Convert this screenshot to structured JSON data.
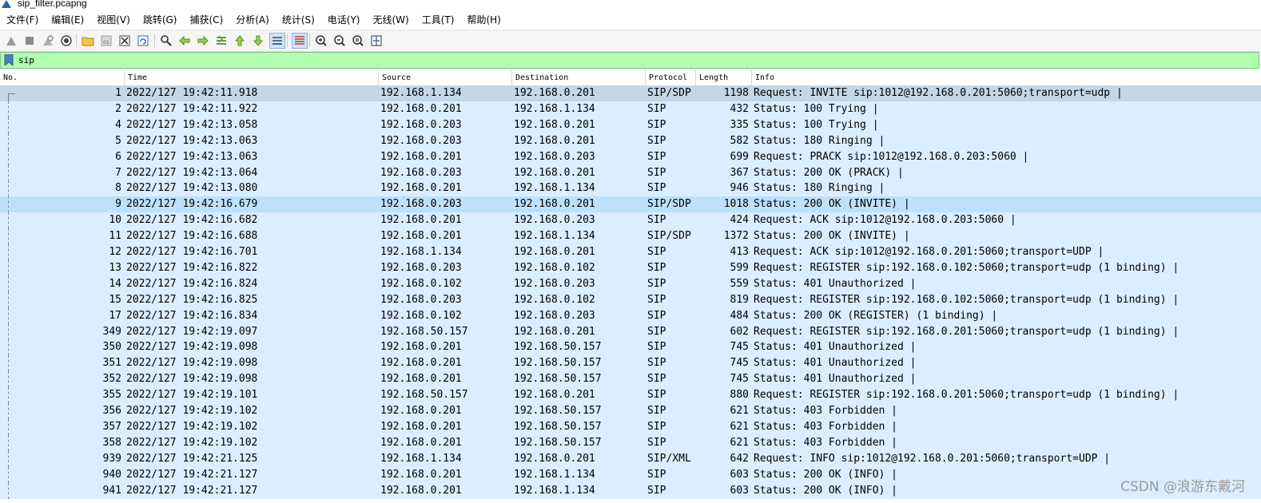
{
  "window": {
    "title": "sip_filter.pcapng"
  },
  "menu": [
    "文件(F)",
    "编辑(E)",
    "视图(V)",
    "跳转(G)",
    "捕获(C)",
    "分析(A)",
    "统计(S)",
    "电话(Y)",
    "无线(W)",
    "工具(T)",
    "帮助(H)"
  ],
  "toolbar_icons": [
    "shark-fin-start-icon",
    "stop-capture-icon",
    "restart-capture-icon",
    "capture-options-icon",
    "open-file-icon",
    "save-file-icon",
    "close-file-icon",
    "reload-file-icon",
    "find-packet-icon",
    "go-back-icon",
    "go-forward-icon",
    "go-to-packet-icon",
    "go-first-packet-icon",
    "go-last-packet-icon",
    "auto-scroll-icon",
    "colorize-icon",
    "zoom-in-icon",
    "zoom-out-icon",
    "zoom-normal-icon",
    "resize-columns-icon"
  ],
  "filter": {
    "value": "sip"
  },
  "columns": [
    "No.",
    "Time",
    "Source",
    "Destination",
    "Protocol",
    "Length",
    "Info"
  ],
  "colors": {
    "row": "#daeeff",
    "selected": "#c4d7e6",
    "highlight": "#bee0fb",
    "filter_bg": "#afffaf"
  },
  "packets": [
    {
      "no": "1",
      "time": "2022/127 19:42:11.918",
      "src": "192.168.1.134",
      "dst": "192.168.0.201",
      "proto": "SIP/SDP",
      "len": "1198",
      "info": "Request: INVITE sip:1012@192.168.0.201:5060;transport=udp |"
    },
    {
      "no": "2",
      "time": "2022/127 19:42:11.922",
      "src": "192.168.0.201",
      "dst": "192.168.1.134",
      "proto": "SIP",
      "len": "432",
      "info": "Status: 100 Trying |"
    },
    {
      "no": "4",
      "time": "2022/127 19:42:13.058",
      "src": "192.168.0.203",
      "dst": "192.168.0.201",
      "proto": "SIP",
      "len": "335",
      "info": "Status: 100 Trying |"
    },
    {
      "no": "5",
      "time": "2022/127 19:42:13.063",
      "src": "192.168.0.203",
      "dst": "192.168.0.201",
      "proto": "SIP",
      "len": "582",
      "info": "Status: 180 Ringing |"
    },
    {
      "no": "6",
      "time": "2022/127 19:42:13.063",
      "src": "192.168.0.201",
      "dst": "192.168.0.203",
      "proto": "SIP",
      "len": "699",
      "info": "Request: PRACK sip:1012@192.168.0.203:5060 |"
    },
    {
      "no": "7",
      "time": "2022/127 19:42:13.064",
      "src": "192.168.0.203",
      "dst": "192.168.0.201",
      "proto": "SIP",
      "len": "367",
      "info": "Status: 200 OK (PRACK) |"
    },
    {
      "no": "8",
      "time": "2022/127 19:42:13.080",
      "src": "192.168.0.201",
      "dst": "192.168.1.134",
      "proto": "SIP",
      "len": "946",
      "info": "Status: 180 Ringing |"
    },
    {
      "no": "9",
      "time": "2022/127 19:42:16.679",
      "src": "192.168.0.203",
      "dst": "192.168.0.201",
      "proto": "SIP/SDP",
      "len": "1018",
      "info": "Status: 200 OK (INVITE) |"
    },
    {
      "no": "10",
      "time": "2022/127 19:42:16.682",
      "src": "192.168.0.201",
      "dst": "192.168.0.203",
      "proto": "SIP",
      "len": "424",
      "info": "Request: ACK sip:1012@192.168.0.203:5060 |"
    },
    {
      "no": "11",
      "time": "2022/127 19:42:16.688",
      "src": "192.168.0.201",
      "dst": "192.168.1.134",
      "proto": "SIP/SDP",
      "len": "1372",
      "info": "Status: 200 OK (INVITE) |"
    },
    {
      "no": "12",
      "time": "2022/127 19:42:16.701",
      "src": "192.168.1.134",
      "dst": "192.168.0.201",
      "proto": "SIP",
      "len": "413",
      "info": "Request: ACK sip:1012@192.168.0.201:5060;transport=UDP |"
    },
    {
      "no": "13",
      "time": "2022/127 19:42:16.822",
      "src": "192.168.0.203",
      "dst": "192.168.0.102",
      "proto": "SIP",
      "len": "599",
      "info": "Request: REGISTER sip:192.168.0.102:5060;transport=udp  (1 binding) |"
    },
    {
      "no": "14",
      "time": "2022/127 19:42:16.824",
      "src": "192.168.0.102",
      "dst": "192.168.0.203",
      "proto": "SIP",
      "len": "559",
      "info": "Status: 401 Unauthorized |"
    },
    {
      "no": "15",
      "time": "2022/127 19:42:16.825",
      "src": "192.168.0.203",
      "dst": "192.168.0.102",
      "proto": "SIP",
      "len": "819",
      "info": "Request: REGISTER sip:192.168.0.102:5060;transport=udp  (1 binding) |"
    },
    {
      "no": "17",
      "time": "2022/127 19:42:16.834",
      "src": "192.168.0.102",
      "dst": "192.168.0.203",
      "proto": "SIP",
      "len": "484",
      "info": "Status: 200 OK (REGISTER)  (1 binding) |"
    },
    {
      "no": "349",
      "time": "2022/127 19:42:19.097",
      "src": "192.168.50.157",
      "dst": "192.168.0.201",
      "proto": "SIP",
      "len": "602",
      "info": "Request: REGISTER sip:192.168.0.201:5060;transport=udp  (1 binding) |"
    },
    {
      "no": "350",
      "time": "2022/127 19:42:19.098",
      "src": "192.168.0.201",
      "dst": "192.168.50.157",
      "proto": "SIP",
      "len": "745",
      "info": "Status: 401 Unauthorized |"
    },
    {
      "no": "351",
      "time": "2022/127 19:42:19.098",
      "src": "192.168.0.201",
      "dst": "192.168.50.157",
      "proto": "SIP",
      "len": "745",
      "info": "Status: 401 Unauthorized |"
    },
    {
      "no": "352",
      "time": "2022/127 19:42:19.098",
      "src": "192.168.0.201",
      "dst": "192.168.50.157",
      "proto": "SIP",
      "len": "745",
      "info": "Status: 401 Unauthorized |"
    },
    {
      "no": "355",
      "time": "2022/127 19:42:19.101",
      "src": "192.168.50.157",
      "dst": "192.168.0.201",
      "proto": "SIP",
      "len": "880",
      "info": "Request: REGISTER sip:192.168.0.201:5060;transport=udp  (1 binding) |"
    },
    {
      "no": "356",
      "time": "2022/127 19:42:19.102",
      "src": "192.168.0.201",
      "dst": "192.168.50.157",
      "proto": "SIP",
      "len": "621",
      "info": "Status: 403 Forbidden |"
    },
    {
      "no": "357",
      "time": "2022/127 19:42:19.102",
      "src": "192.168.0.201",
      "dst": "192.168.50.157",
      "proto": "SIP",
      "len": "621",
      "info": "Status: 403 Forbidden |"
    },
    {
      "no": "358",
      "time": "2022/127 19:42:19.102",
      "src": "192.168.0.201",
      "dst": "192.168.50.157",
      "proto": "SIP",
      "len": "621",
      "info": "Status: 403 Forbidden |"
    },
    {
      "no": "939",
      "time": "2022/127 19:42:21.125",
      "src": "192.168.1.134",
      "dst": "192.168.0.201",
      "proto": "SIP/XML",
      "len": "642",
      "info": "Request: INFO sip:1012@192.168.0.201:5060;transport=UDP |"
    },
    {
      "no": "940",
      "time": "2022/127 19:42:21.127",
      "src": "192.168.0.201",
      "dst": "192.168.1.134",
      "proto": "SIP",
      "len": "603",
      "info": "Status: 200 OK (INFO) |"
    },
    {
      "no": "941",
      "time": "2022/127 19:42:21.127",
      "src": "192.168.0.201",
      "dst": "192.168.1.134",
      "proto": "SIP",
      "len": "603",
      "info": "Status: 200 OK (INFO) |"
    }
  ],
  "selected_packet": "1",
  "highlighted_packet": "9",
  "watermark": "CSDN @浪游东戴河"
}
